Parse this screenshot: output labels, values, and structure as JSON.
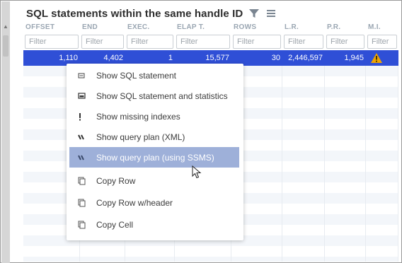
{
  "panel": {
    "title": "SQL statements within the same handle ID",
    "filter_icon": "filter-icon",
    "menu_icon": "hamburger-icon"
  },
  "grid": {
    "columns": [
      "OFFSET",
      "END",
      "EXEC.",
      "ELAP T.",
      "ROWS",
      "L.R.",
      "P.R.",
      "M.I."
    ],
    "filter_placeholder": "Filter",
    "filter_placeholder_truncated": "Filter",
    "selected_row": [
      "1,110",
      "4,402",
      "1",
      "15,577",
      "30",
      "2,446,597",
      "1,945"
    ],
    "selected_row_flag_icon": "warning-icon",
    "colors": {
      "selected_row": "#2f4fd6",
      "warning": "#f0a500",
      "menu_highlight": "#9eb0d9"
    }
  },
  "context_menu": {
    "items": [
      {
        "label": "Show SQL statement",
        "icon": "statement-icon"
      },
      {
        "label": "Show SQL statement and statistics",
        "icon": "statement-stats-icon"
      },
      {
        "label": "Show missing indexes",
        "icon": "exclamation-icon"
      },
      {
        "label": "Show query plan (XML)",
        "icon": "query-plan-icon"
      },
      {
        "label": "Show query plan (using SSMS)",
        "icon": "query-plan-ssms-icon",
        "highlighted": true
      },
      {
        "label": "Copy Row",
        "icon": "copy-icon"
      },
      {
        "label": "Copy Row w/header",
        "icon": "copy-icon"
      },
      {
        "label": "Copy Cell",
        "icon": "copy-icon"
      }
    ]
  }
}
